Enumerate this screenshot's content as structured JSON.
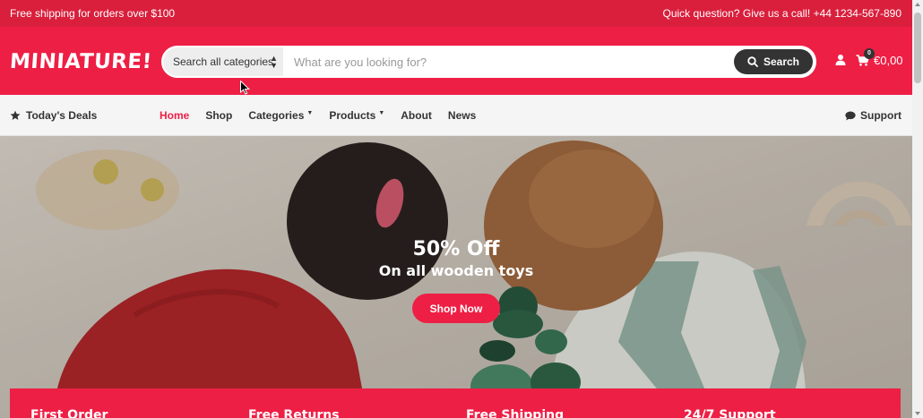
{
  "topbar": {
    "shipping_text": "Free shipping for orders over $100",
    "contact_text": "Quick question? Give us a call! +44 1234-567-890"
  },
  "header": {
    "logo_text": "MINIATURE!",
    "search": {
      "category_label": "Search all categories",
      "placeholder": "What are you looking for?",
      "button_label": "Search"
    },
    "cart": {
      "count": "0",
      "total": "€0,00"
    }
  },
  "nav": {
    "deals_label": "Today's Deals",
    "items": [
      {
        "label": "Home",
        "active": true
      },
      {
        "label": "Shop"
      },
      {
        "label": "Categories",
        "dropdown": true
      },
      {
        "label": "Products",
        "dropdown": true
      },
      {
        "label": "About"
      },
      {
        "label": "News"
      }
    ],
    "support_label": "Support"
  },
  "hero": {
    "title": "50% Off",
    "subtitle": "On all wooden toys",
    "button_label": "Shop Now"
  },
  "features": [
    {
      "label": "First Order"
    },
    {
      "label": "Free Returns"
    },
    {
      "label": "Free Shipping"
    },
    {
      "label": "24/7 Support"
    }
  ],
  "colors": {
    "brand_red": "#ee1f45",
    "topbar_red": "#d91f3c",
    "dark": "#333333"
  },
  "icons": {
    "deals": "star-icon",
    "search": "search-icon",
    "user": "user-icon",
    "cart": "cart-icon",
    "support": "chat-bubble-icon"
  }
}
